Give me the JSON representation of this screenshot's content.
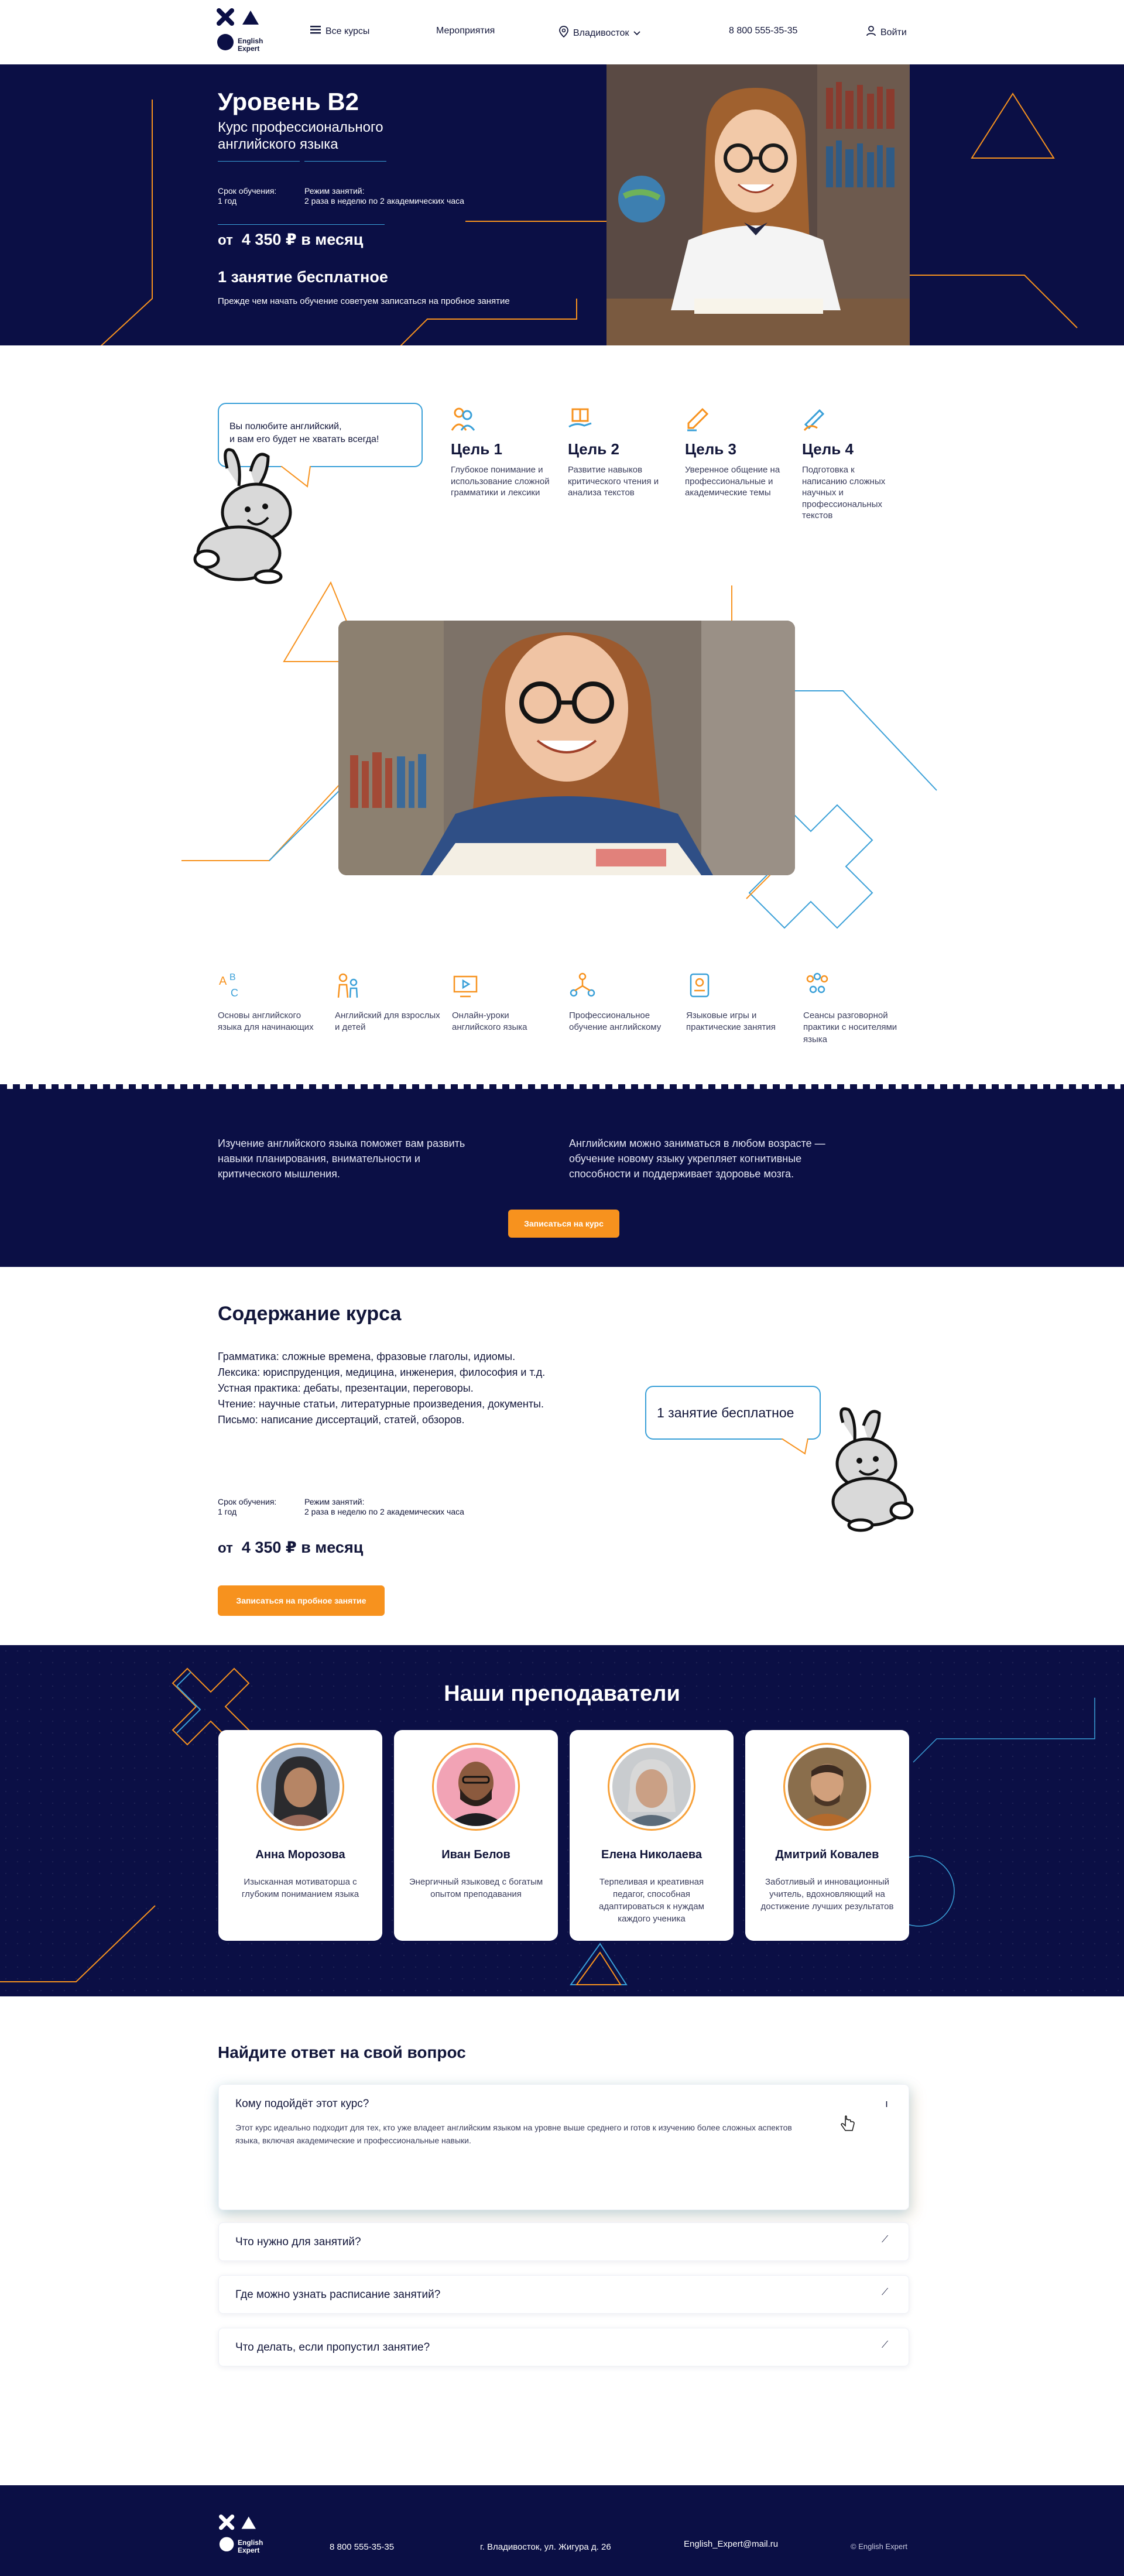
{
  "header": {
    "logo_text_1": "English",
    "logo_text_2": "Expert",
    "all_courses": "Все курсы",
    "events": "Мероприятия",
    "city": "Владивосток",
    "phone": "8 800 555-35-35",
    "login": "Войти"
  },
  "hero": {
    "title": "Уровень B2",
    "subtitle": "Курс профессионального английского языка",
    "duration_label": "Срок обучения:",
    "duration_value": "1 год",
    "mode_label": "Режим занятий:",
    "mode_value": "2 раза в неделю по 2 академических часа",
    "price_prefix": "от",
    "price": "4 350 ₽ в месяц",
    "free_lesson": "1 занятие бесплатное",
    "advice": "Прежде чем начать обучение советуем записаться на пробное занятие"
  },
  "bubble": {
    "line1": "Вы полюбите английский,",
    "line2": "и вам его будет не хватать всегда!"
  },
  "goals": [
    {
      "title": "Цель 1",
      "desc": "Глубокое понимание и использование сложной грамматики и лексики",
      "icon": "people-icon"
    },
    {
      "title": "Цель 2",
      "desc": "Развитие навыков критического чтения и анализа текстов",
      "icon": "book-hand-icon"
    },
    {
      "title": "Цель 3",
      "desc": "Уверенное общение на профессиональные и академические темы",
      "icon": "pen-icon"
    },
    {
      "title": "Цель 4",
      "desc": "Подготовка к написанию сложных научных и профессиональных текстов",
      "icon": "hand-writing-icon"
    }
  ],
  "features": [
    {
      "label": "Основы английского языка для начинающих",
      "icon": "abc-icon"
    },
    {
      "label": "Английский для взрослых и детей",
      "icon": "family-icon"
    },
    {
      "label": "Онлайн-уроки английского языка",
      "icon": "video-icon"
    },
    {
      "label": "Профессиональное обучение английскому",
      "icon": "network-icon"
    },
    {
      "label": "Языковые игры и практические занятия",
      "icon": "game-icon"
    },
    {
      "label": "Сеансы разговорной практики с носителями языка",
      "icon": "group-icon"
    }
  ],
  "benefits": {
    "left": "Изучение английского языка поможет вам развить навыки планирования, внимательности и критического мышления.",
    "right": "Английским можно заниматься в любом возрасте — обучение новому языку укрепляет когнитивные способности и поддерживает здоровье мозга.",
    "button": "Записаться на курс"
  },
  "content": {
    "title": "Содержание курса",
    "lines": [
      "Грамматика: сложные времена, фразовые глаголы, идиомы.",
      "Лексика: юриспруденция, медицина, инженерия, философия и т.д.",
      "Устная практика: дебаты, презентации, переговоры.",
      "Чтение: научные статьи, литературные произведения, документы.",
      "Письмо: написание диссертаций, статей, обзоров."
    ],
    "bubble": "1 занятие бесплатное",
    "duration_label": "Срок обучения:",
    "duration_value": "1 год",
    "mode_label": "Режим занятий:",
    "mode_value": "2 раза в неделю по 2 академических часа",
    "price_prefix": "от",
    "price": "4 350 ₽ в месяц",
    "button": "Записаться на пробное занятие"
  },
  "teachers": {
    "title": "Наши преподаватели",
    "items": [
      {
        "name": "Анна Морозова",
        "desc": "Изысканная мотиваторша с глубоким пониманием языка"
      },
      {
        "name": "Иван Белов",
        "desc": "Энергичный языковед с богатым опытом преподавания"
      },
      {
        "name": "Елена Николаева",
        "desc": "Терпеливая и креативная педагог, способная адаптироваться к нуждам каждого ученика"
      },
      {
        "name": "Дмитрий Ковалев",
        "desc": "Заботливый и инновационный учитель, вдохновляющий на достижение лучших результатов"
      }
    ]
  },
  "faq": {
    "title": "Найдите ответ на свой вопрос",
    "items": [
      {
        "q": "Кому подойдёт этот курс?",
        "a": "Этот курс идеально подходит для тех, кто уже владеет английским языком на уровне выше среднего и готов к изучению более сложных аспектов языка, включая академические и профессиональные навыки."
      },
      {
        "q": "Что нужно для занятий?"
      },
      {
        "q": "Где можно узнать расписание занятий?"
      },
      {
        "q": "Что делать, если пропустил занятие?"
      }
    ]
  },
  "footer": {
    "logo_text_1": "English",
    "logo_text_2": "Expert",
    "phone": "8 800 555-35-35",
    "address": "г. Владивосток, ул. Жигура д. 26",
    "email": "English_Expert@mail.ru",
    "copyright": "© English Expert"
  },
  "colors": {
    "navy": "#0b0f45",
    "orange": "#f7921e",
    "blue_line": "#3aa0d8"
  }
}
